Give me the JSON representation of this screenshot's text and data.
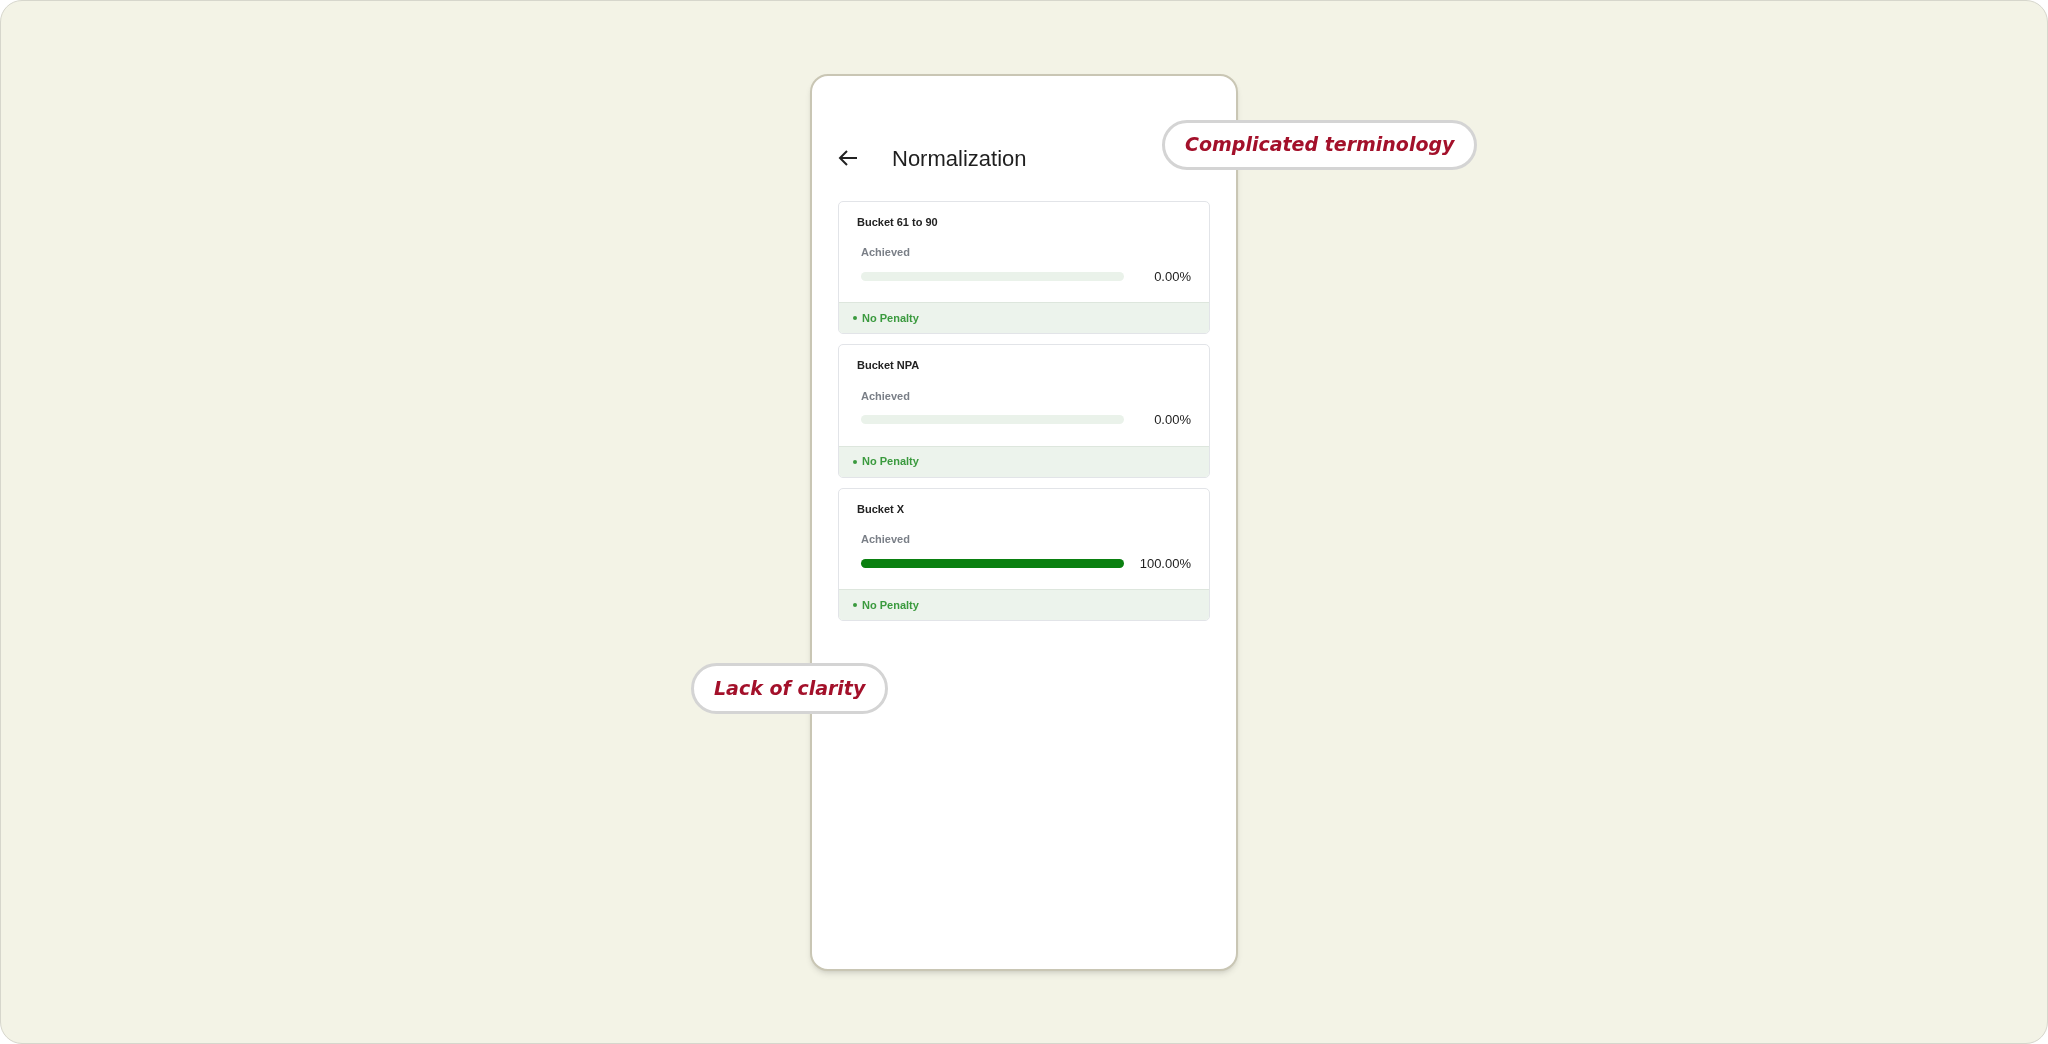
{
  "screen": {
    "title": "Normalization"
  },
  "cards": [
    {
      "title": "Bucket 61 to 90",
      "label": "Achieved",
      "level": 0,
      "reading": "0.00%",
      "status": "No Penalty"
    },
    {
      "title": "Bucket NPA",
      "label": "Achieved",
      "level": 0,
      "reading": "0.00%",
      "status": "No Penalty"
    },
    {
      "title": "Bucket X",
      "label": "Achieved",
      "level": 1,
      "reading": "100.00%",
      "status": "No Penalty"
    }
  ],
  "callouts": [
    "Complicated terminology",
    "Lack of clarity"
  ]
}
